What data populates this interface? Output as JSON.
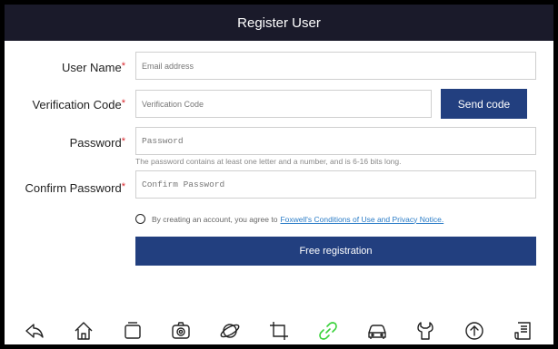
{
  "header": {
    "title": "Register User"
  },
  "form": {
    "required_marker": "*",
    "user_name": {
      "label": "User Name",
      "placeholder": "Email address"
    },
    "verification": {
      "label": "Verification Code",
      "placeholder": "Verification Code",
      "send_label": "Send code"
    },
    "password": {
      "label": "Password",
      "placeholder": "Password",
      "hint": "The password contains at least one letter and a number, and is 6-16 bits long."
    },
    "confirm": {
      "label": "Confirm Password",
      "placeholder": "Confirm Password"
    },
    "agreement": {
      "text": "By creating an account, you agree to",
      "link": "Foxwell's Conditions of Use and Privacy Notice."
    },
    "submit_label": "Free registration"
  },
  "navbar": {
    "icons": [
      "back-icon",
      "home-icon",
      "recent-apps-icon",
      "camera-icon",
      "browser-icon",
      "crop-icon",
      "link-icon",
      "car-icon",
      "wrench-icon",
      "update-icon",
      "document-icon"
    ],
    "active_icon": "link-icon"
  },
  "colors": {
    "accent": "#223f7f",
    "required": "#d9262c",
    "link": "#2a7cc7",
    "active_icon": "#39d23a",
    "title_bar": "#1a1a2a"
  }
}
